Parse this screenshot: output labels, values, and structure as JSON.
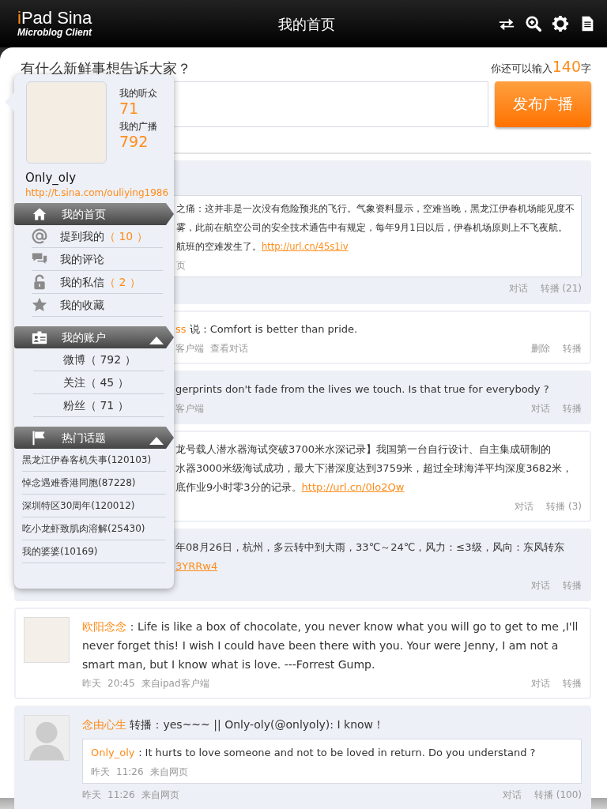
{
  "header": {
    "logo_accent": "i",
    "logo_rest": "Pad Sina",
    "logo_subtitle": "Microblog Client",
    "title": "我的首页"
  },
  "compose": {
    "prompt": "有什么新鲜事想告诉大家？",
    "counter_prefix": "你还可以输入",
    "counter": "140",
    "counter_suffix": "字",
    "submit": "发布广播"
  },
  "profile_popover": {
    "followers_label": "我的听众",
    "followers": "71",
    "posts_label": "我的广播",
    "posts": "792",
    "username": "Only_oly",
    "url": "http://t.sina.com/ouliying1986",
    "menu": [
      {
        "label": "我的首页",
        "selected": true
      },
      {
        "label": "提到我的",
        "count": "（ 10 ）",
        "selected": false
      },
      {
        "label": "我的评论",
        "selected": false
      },
      {
        "label": "我的私信",
        "count": "（ 2 ）",
        "selected": false
      },
      {
        "label": "我的收藏",
        "selected": false
      }
    ],
    "sections": [
      {
        "title": "我的账户",
        "expanded": true,
        "items": [
          "微博（ 792 ）",
          "关注（ 45 ）",
          "粉丝（ 71 ）"
        ]
      },
      {
        "title": "热门话题",
        "expanded": true,
        "items": [
          "黑龙江伊春客机失事(120103)",
          "悼念遇难香港同胞(87228)",
          "深圳特区30周年(120012)",
          "吃小龙虾致肌肉溶解(25430)",
          "我的婆婆(10169)"
        ]
      }
    ]
  },
  "feed": [
    {
      "kind": "partial",
      "shaded": true,
      "quote": {
        "lines": [
          {
            "text": "之痛：这并非是一次没有危险预兆的飞行。气象资料显示，空难当晚，黑龙江伊春机场能见度不"
          },
          {
            "text": "雾，此前在航空公司的安全技术通告中有规定，每年9月1日以后，伊春机场原则上不飞夜航。"
          },
          {
            "text": "航班的空难发生了。",
            "link": "http://url.cn/45s1iv"
          }
        ],
        "meta": [
          "页"
        ]
      },
      "actions": [
        "对话",
        "转播 (21)"
      ]
    },
    {
      "kind": "partial",
      "shaded": false,
      "lines": [
        {
          "author": "ss",
          "text": " 说：Comfort is better than pride."
        }
      ],
      "meta": [
        "客户端",
        "查看对话"
      ],
      "actions": [
        "删除",
        "转播"
      ]
    },
    {
      "kind": "partial",
      "shaded": true,
      "lines": [
        {
          "text": "gerprints don't fade from the lives we touch.  Is that true for everybody ?"
        }
      ],
      "meta": [
        "客户端"
      ],
      "actions": [
        "对话",
        "转播"
      ]
    },
    {
      "kind": "partial",
      "shaded": false,
      "lines": [
        {
          "text": "龙号载人潜水器海试突破3700米水深记录】我国第一台自行设计、自主集成研制的"
        },
        {
          "text": "水器3000米级海试成功，最大下潜深度达到3759米，超过全球海洋平均深度3682米，"
        },
        {
          "text": "底作业9小时零3分的记录。",
          "link": "http://url.cn/0lo2Qw"
        }
      ],
      "actions": [
        "对话",
        "转播 (3)"
      ]
    },
    {
      "kind": "partial",
      "shaded": true,
      "lines": [
        {
          "text": "年08月26日，杭州，多云转中到大雨，33℃～24℃，风力：≤3级，风向：东风转东"
        },
        {
          "link": "3YRRw4"
        }
      ],
      "actions": [
        "对话",
        "转播"
      ]
    },
    {
      "kind": "full",
      "shaded": false,
      "lines": [
        {
          "author": "欧阳念念",
          "text": "：Life is like a box of chocolate, you never know what you will go to get to me ,I'll never forget this! I wish I could have been there with you. Your were Jenny, I am not a smart man, but I know what is love. ---Forrest Gump."
        }
      ],
      "meta": [
        "昨天",
        "20:45",
        "来自ipad客户端"
      ],
      "actions": [
        "对话",
        "转播"
      ]
    },
    {
      "kind": "full",
      "shaded": true,
      "lines": [
        {
          "author": "念由心生",
          "text": " 转播：yes~~~ || Only-oly(@onlyoly): I know！"
        }
      ],
      "quote": {
        "lines": [
          {
            "author": "Only_oly",
            "text": "：It hurts to love someone and not to be loved in return. Do you understand ?"
          }
        ],
        "meta": [
          "昨天",
          "11:26",
          "来自网页"
        ]
      },
      "meta": [
        "昨天",
        "11:26",
        "来自网页"
      ],
      "actions": [
        "对话",
        "转播 (100)"
      ]
    }
  ]
}
